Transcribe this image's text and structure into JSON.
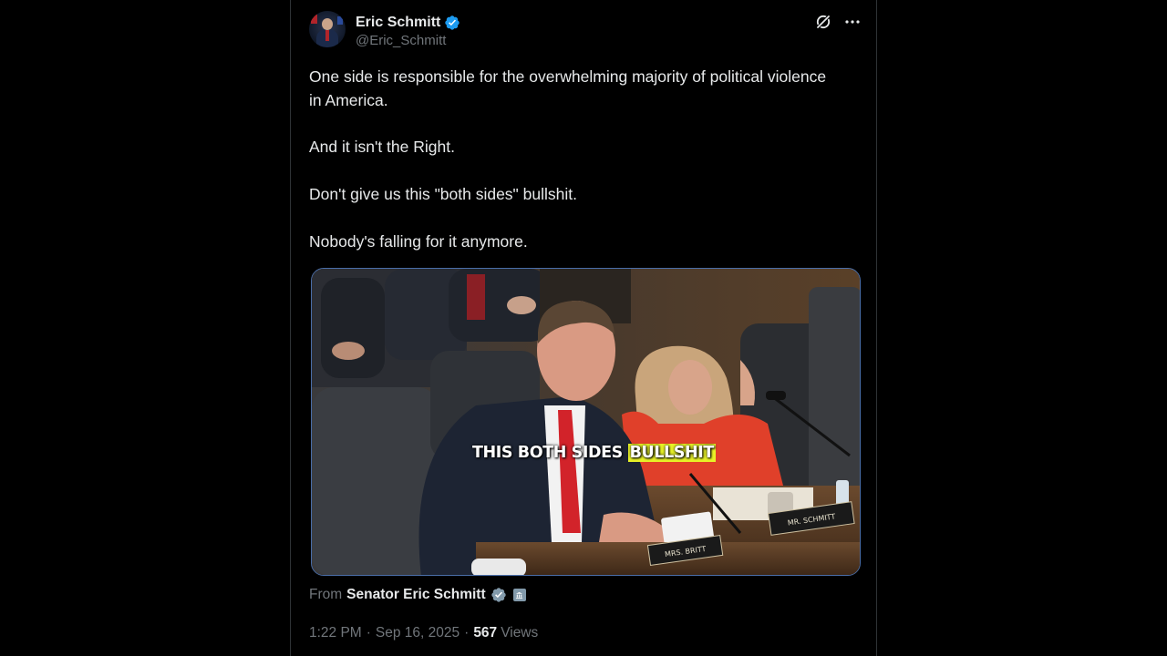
{
  "tweet": {
    "author": {
      "display_name": "Eric Schmitt",
      "handle": "@Eric_Schmitt",
      "verified": true,
      "verified_color": "#1d9bf0"
    },
    "paragraphs": [
      "One side is responsible for the overwhelming majority of political violence in America.",
      "And it isn't the Right.",
      "Don't give us this \"both sides\" bullshit.",
      "Nobody's falling for it anymore."
    ],
    "media": {
      "caption_prefix": "THIS BOTH SIDES ",
      "caption_highlight": "BULLSHIT",
      "caption_highlight_color": "#e8f227",
      "placards": [
        "MRS. BRITT",
        "MR. SCHMITT"
      ]
    },
    "attribution": {
      "from_label": "From",
      "source_name": "Senator Eric Schmitt",
      "source_verified_color": "#829aab"
    },
    "meta": {
      "time": "1:22 PM",
      "separator": "·",
      "date": "Sep 16, 2025",
      "views_count": "567",
      "views_label": "Views"
    }
  },
  "icons": {
    "grok": "grok-icon",
    "more": "more-icon"
  },
  "colors": {
    "background": "#000000",
    "text": "#e7e9ea",
    "secondary_text": "#71767b",
    "border": "#2f3336"
  }
}
